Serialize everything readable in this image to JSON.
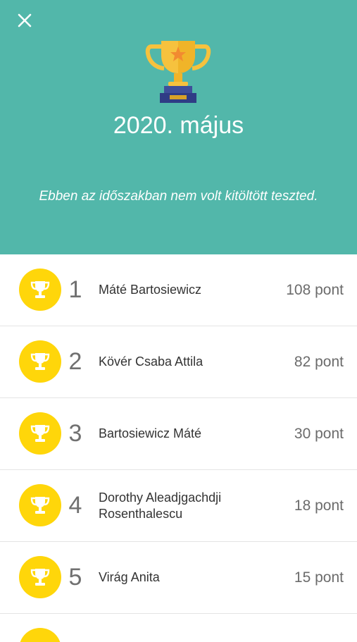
{
  "header": {
    "close_icon": "close-icon",
    "trophy_icon": "trophy-icon",
    "title": "2020. május",
    "subtitle": "Ebben az időszakban nem volt kitöltött teszted.",
    "background_color": "#52B7AA"
  },
  "leaderboard": {
    "rows": [
      {
        "rank": "1",
        "name": "Máté Bartosiewicz",
        "points": "108 pont"
      },
      {
        "rank": "2",
        "name": "Kövér Csaba Attila",
        "points": "82 pont"
      },
      {
        "rank": "3",
        "name": "Bartosiewicz Máté",
        "points": "30 pont"
      },
      {
        "rank": "4",
        "name": "Dorothy Aleadjgachdji Rosenthalescu",
        "points": "18 pont"
      },
      {
        "rank": "5",
        "name": "Virág Anita",
        "points": "15 pont"
      }
    ],
    "badge_color": "#FFD60A"
  }
}
